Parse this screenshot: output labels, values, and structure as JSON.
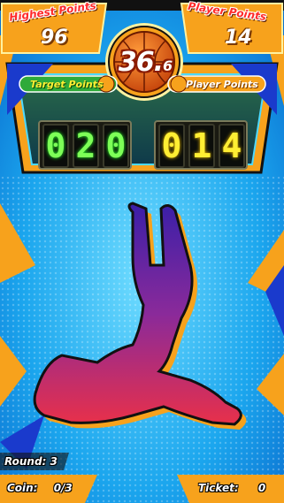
{
  "hud": {
    "highest_points_label": "Highest Points",
    "highest_points_value": "96",
    "player_points_label": "Player Points",
    "player_points_value": "14",
    "timer_main": "36.",
    "timer_decimal": "6"
  },
  "scoreboard": {
    "target_label": "Target Points",
    "player_label": "Player Points",
    "target_digits": [
      "0",
      "2",
      "0"
    ],
    "player_digits": [
      "0",
      "1",
      "4"
    ]
  },
  "footer": {
    "round_label": "Round:",
    "round_value": "3",
    "coin_label": "Coin:",
    "coin_value": "0/3",
    "ticket_label": "Ticket:",
    "ticket_value": "0"
  },
  "colors": {
    "background": "#1a9fe8",
    "panel_orange": "#f7a21c",
    "target_green": "#7dff57",
    "player_yellow": "#ffee33",
    "label_red": "#ff2a2a"
  },
  "icons": {
    "timer": "basketball-icon",
    "player_silhouette": "jumping-player-silhouette"
  }
}
